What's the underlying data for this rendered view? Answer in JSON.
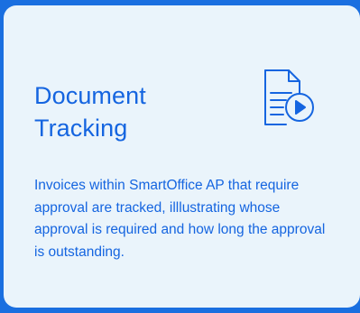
{
  "card": {
    "title": "Document Tracking",
    "icon": "document-playback-icon",
    "description": "Invoices within SmartOffice AP that require approval are tracked, illlustrating whose approval is required and how long the approval is outstanding."
  },
  "colors": {
    "background": "#1a6fe0",
    "card": "#eaf4fb",
    "accent": "#1565e0"
  }
}
